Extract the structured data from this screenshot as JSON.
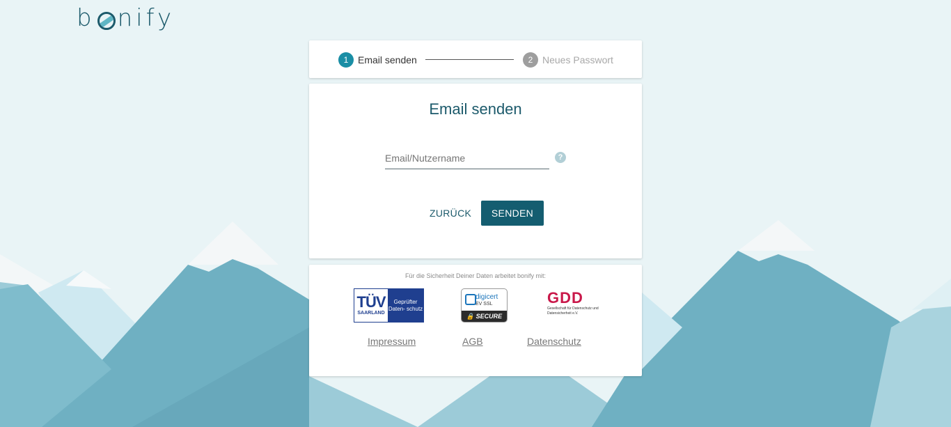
{
  "brand": {
    "logo_text_left": "b",
    "logo_text_right": "nify"
  },
  "stepper": {
    "steps": [
      {
        "number": "1",
        "label": "Email senden"
      },
      {
        "number": "2",
        "label": "Neues Passwort"
      }
    ]
  },
  "form": {
    "title": "Email senden",
    "email_placeholder": "Email/Nutzername",
    "help_symbol": "?",
    "back_label": "ZURÜCK",
    "send_label": "SENDEN"
  },
  "footer": {
    "security_text": "Für die Sicherheit Deiner Daten arbeitet bonify mit:",
    "tuv": {
      "brand": "TÜV",
      "region": "SAARLAND",
      "text": "Geprüfter Daten- schutz"
    },
    "digicert": {
      "brand": "digicert",
      "type": "EV SSL",
      "badge": "SECURE"
    },
    "gdd": {
      "brand": "GDD",
      "subtitle": "Gesellschaft für Datenschutz und Datensicherheit e.V."
    },
    "links": [
      "Impressum",
      "AGB",
      "Datenschutz"
    ]
  },
  "colors": {
    "accent": "#1a8ea5",
    "primary_button": "#145d70",
    "title": "#1c5a6b",
    "background": "#e9f4f6"
  }
}
